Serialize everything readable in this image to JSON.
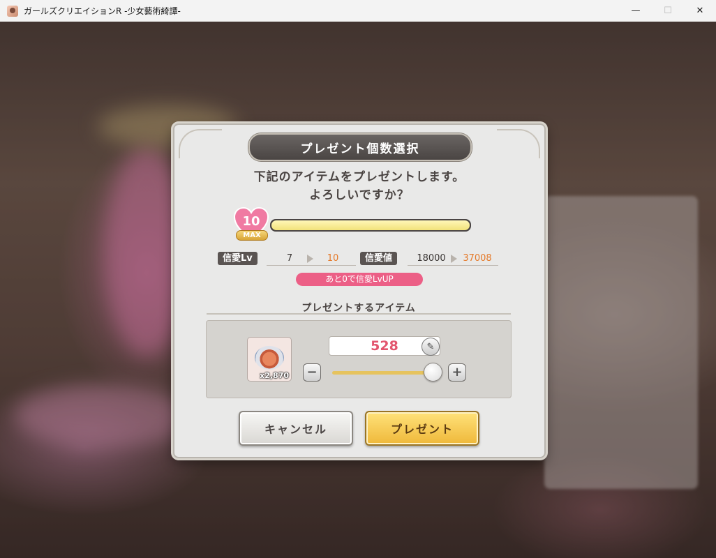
{
  "window": {
    "title": "ガールズクリエイションR -少女藝術綺譚-",
    "minimize_glyph": "—",
    "maximize_glyph": "☐",
    "close_glyph": "✕"
  },
  "dialog": {
    "title": "プレゼント個数選択",
    "message_line1": "下記のアイテムをプレゼントします。",
    "message_line2": "よろしいですか？",
    "affection_level_badge": "10",
    "max_label": "MAX",
    "gauge_fill_fraction": 1.0,
    "stats": {
      "level_label": "信愛Lv",
      "level_current": "7",
      "level_next": "10",
      "points_label": "信愛値",
      "points_current": "18000",
      "points_next": "37008"
    },
    "levelup_note": "あと0で信愛LvUP",
    "section_heading": "プレゼントするアイテム",
    "item": {
      "icon": "food-dish-icon",
      "owned_count": "x2,870"
    },
    "quantity": "528",
    "slider_fraction": 0.95,
    "minus_glyph": "−",
    "plus_glyph": "+",
    "edit_glyph": "✎",
    "cancel_label": "キャンセル",
    "present_label": "プレゼント"
  }
}
